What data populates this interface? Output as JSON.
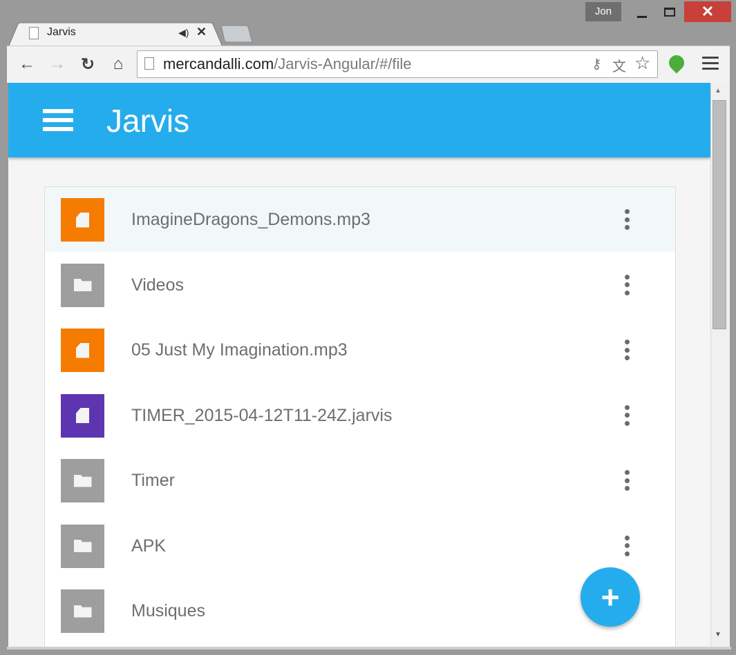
{
  "window": {
    "user_name": "Jon",
    "close_glyph": "✕"
  },
  "tab": {
    "title": "Jarvis",
    "audio_glyph": "◀)",
    "close_glyph": "✕"
  },
  "toolbar": {
    "back_glyph": "←",
    "forward_glyph": "→",
    "reload_glyph": "↻",
    "home_glyph": "⌂",
    "url_host": "mercandalli.com",
    "url_path": "/Jarvis-Angular/#/file",
    "key_glyph": "⚷",
    "translate_glyph": "文",
    "star_glyph": "☆"
  },
  "app": {
    "title": "Jarvis",
    "accent_color": "#25acec",
    "fab_glyph": "+"
  },
  "files": [
    {
      "name": "ImagineDragons_Demons.mp3",
      "type": "file",
      "color": "#f57c00",
      "active": true
    },
    {
      "name": "Videos",
      "type": "folder",
      "color": "#9e9e9e",
      "active": false
    },
    {
      "name": "05 Just My Imagination.mp3",
      "type": "file",
      "color": "#f57c00",
      "active": false
    },
    {
      "name": "TIMER_2015-04-12T11-24Z.jarvis",
      "type": "file",
      "color": "#5e35b1",
      "active": false
    },
    {
      "name": "Timer",
      "type": "folder",
      "color": "#9e9e9e",
      "active": false
    },
    {
      "name": "APK",
      "type": "folder",
      "color": "#9e9e9e",
      "active": false
    },
    {
      "name": "Musiques",
      "type": "folder",
      "color": "#9e9e9e",
      "active": false
    }
  ],
  "scrollbar": {
    "up_glyph": "▲",
    "down_glyph": "▼"
  }
}
